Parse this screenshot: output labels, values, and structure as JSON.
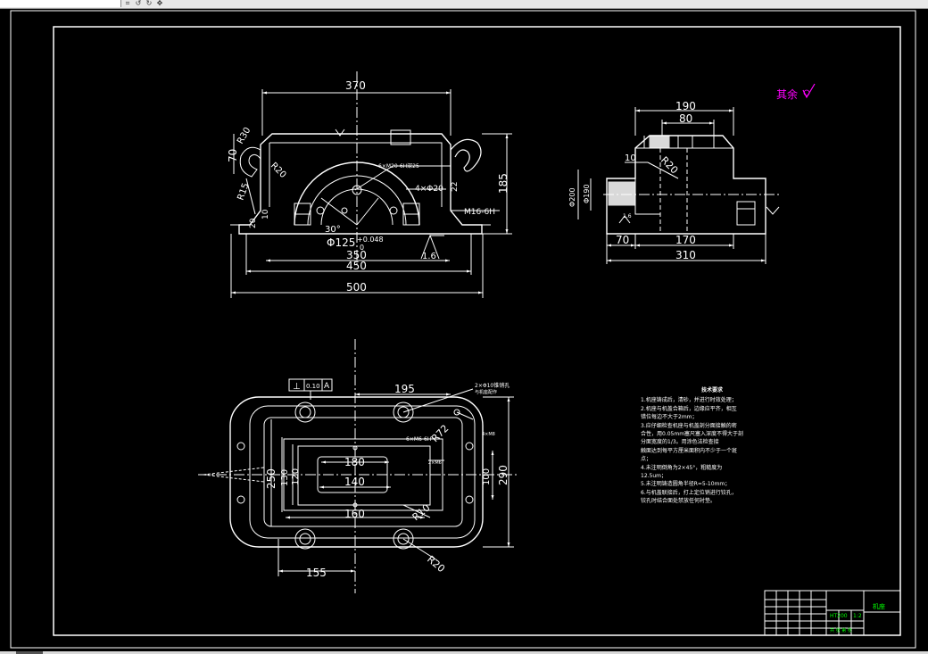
{
  "dims": {
    "front": {
      "overall_width": "370",
      "height": "185",
      "h70": "70",
      "r30": "R30",
      "r20": "R20",
      "r15": "R15",
      "d20": "20",
      "d10": "10",
      "thread_top": "6×M20-6H深25",
      "holes": "4×Φ20",
      "r22": "22",
      "m16": "M16-6H",
      "deg30": "30°",
      "bore": "Φ125",
      "tol_upper": "+0.048",
      "tol_lower": "0",
      "rough": "1.6",
      "w350": "350",
      "w450": "450",
      "w500": "500"
    },
    "side": {
      "w190": "190",
      "w80": "80",
      "d10": "10",
      "r20": "R20",
      "d200": "Φ200",
      "d190": "Φ190",
      "rough": "1.6",
      "w70": "70",
      "w170": "170",
      "w310": "310"
    },
    "plan": {
      "gdt_symbol": "⊥",
      "gdt_value": "0.10",
      "gdt_datum": "A",
      "w195": "195",
      "holes_note": "2×Φ10锥销孔",
      "holes_note2": "与机座配作",
      "r72": "R72",
      "thread": "6×M6-6H",
      "hole_note_small": "4×M8",
      "small_lbl": "2×M6",
      "w180": "180",
      "w140": "140",
      "w160": "160",
      "h250": "250",
      "h130": "130",
      "h120": "120",
      "h100": "100",
      "h290": "290",
      "r10": "R10",
      "r20": "R20",
      "w155": "155"
    }
  },
  "surface_note": "其余",
  "tech_requirements": {
    "title": "技术要求",
    "lines": [
      "1.机座铸成后，清砂，并进行时效处理；",
      "2.机座与机盖合箱后，边缘应平齐，相互",
      "错位每边不大于2mm；",
      "3.应仔细检查机座与机盖剖分面接触的密",
      "合性，用0.05mm塞尺塞入深度不得大于剖",
      "分面宽度的1/3。用涂色法检查接",
      "触面达到每平方厘米面积内不少于一个斑",
      "点；",
      "4.未注明倒角为2×45°，粗糙度为",
      "12.5um；",
      "5.未注明铸造圆角半径R=5-10mm；",
      "6.与机盖联接后，打上定位销进行铰孔，",
      "铰孔时结合面处禁放任何衬垫。"
    ]
  },
  "title_block": {
    "name": "机座",
    "material": "HT200",
    "scale": "1:2",
    "sheet": "共 张 第 张"
  },
  "colors": {
    "background": "#000000",
    "lines": "#ffffff",
    "annotation": "#ff00ff",
    "title_text": "#00ff00",
    "toolbar": "#e8e8e8"
  }
}
